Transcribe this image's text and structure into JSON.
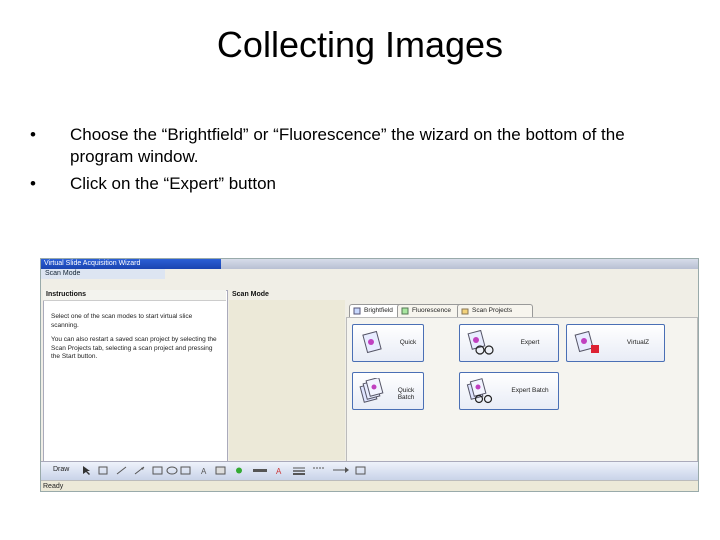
{
  "slide": {
    "title": "Collecting Images",
    "bullets": [
      {
        "marker": "•",
        "text": "Choose the “Brightfield” or “Fluorescence” the wizard on the bottom of the program window."
      },
      {
        "marker": "•",
        "text": "Click on the “Expert” button"
      }
    ]
  },
  "app": {
    "window_title": "Virtual Slide Acquisition Wizard",
    "mode_bar": "Scan Mode",
    "instructions": {
      "heading": "Instructions",
      "paragraphs": [
        "Select one of the scan modes to start virtual slice scanning.",
        "You can also restart a saved scan project by selecting the Scan Projects tab, selecting a scan project and pressing the Start button."
      ]
    },
    "scan_mode": {
      "heading": "Scan Mode",
      "tabs": [
        {
          "label": "Brightfield",
          "active": true,
          "icon": "brightfield-icon"
        },
        {
          "label": "Fluorescence",
          "active": false,
          "icon": "fluorescence-icon"
        },
        {
          "label": "Scan Projects",
          "active": false,
          "icon": "projects-icon"
        }
      ],
      "buttons": [
        {
          "label": "Quick",
          "icon": "quick-slide-icon"
        },
        {
          "label": "Expert",
          "icon": "expert-glasses-icon"
        },
        {
          "label": "VirtualZ",
          "icon": "virtualz-icon"
        },
        {
          "label": "Quick Batch",
          "icon": "quick-batch-icon"
        },
        {
          "label": "Expert Batch",
          "icon": "expert-batch-icon"
        }
      ]
    },
    "draw_toolbar": {
      "label": "Draw"
    },
    "status": "Ready",
    "colors": {
      "accent": "#2b5fd6",
      "button_border": "#4a6fb5"
    }
  }
}
